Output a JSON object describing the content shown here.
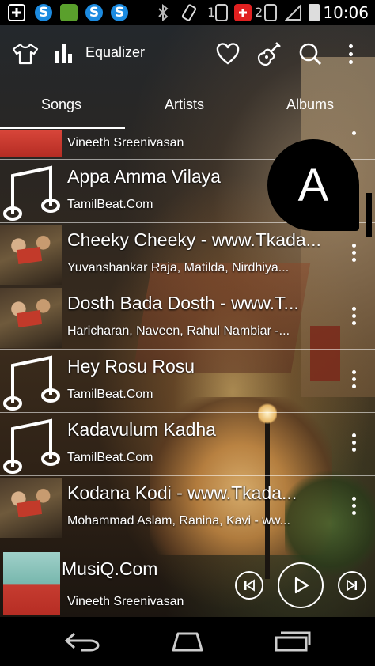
{
  "status_bar": {
    "time": "10:06",
    "badges": [
      "1",
      "2"
    ]
  },
  "toolbar": {
    "equalizer_label": "Equalizer",
    "icons": [
      "shirt-icon",
      "equalizer-icon",
      "heart-icon",
      "guitar-icon",
      "search-icon",
      "more-vertical-icon"
    ]
  },
  "tabs": [
    {
      "label": "Songs",
      "active": true
    },
    {
      "label": "Artists",
      "active": false
    },
    {
      "label": "Albums",
      "active": false
    }
  ],
  "fast_scroll_letter": "A",
  "songs": [
    {
      "title": "",
      "artist": "Vineeth Sreenivasan",
      "art": "red"
    },
    {
      "title": "Appa Amma Vilaya",
      "artist": "TamilBeat.Com",
      "art": "note"
    },
    {
      "title": "Cheeky Cheeky - www.Tkada...",
      "artist": "Yuvanshankar Raja, Matilda, Nirdhiya...",
      "art": "photo"
    },
    {
      "title": "Dosth Bada Dosth - www.T...",
      "artist": "Haricharan, Naveen, Rahul Nambiar -...",
      "art": "photo"
    },
    {
      "title": "Hey Rosu Rosu",
      "artist": "TamilBeat.Com",
      "art": "note"
    },
    {
      "title": "Kadavulum Kadha",
      "artist": "TamilBeat.Com",
      "art": "note"
    },
    {
      "title": "Kodana Kodi - www.Tkada...",
      "artist": "Mohammad Aslam, Ranina, Kavi - ww...",
      "art": "photo"
    }
  ],
  "now_playing": {
    "title": "MusiQ.Com",
    "artist": "Vineeth Sreenivasan",
    "controls": [
      "previous-button",
      "play-button",
      "next-button"
    ]
  },
  "colors": {
    "text": "#ffffff",
    "status_bar_bg": "#000000",
    "divider": "#ffffff"
  }
}
